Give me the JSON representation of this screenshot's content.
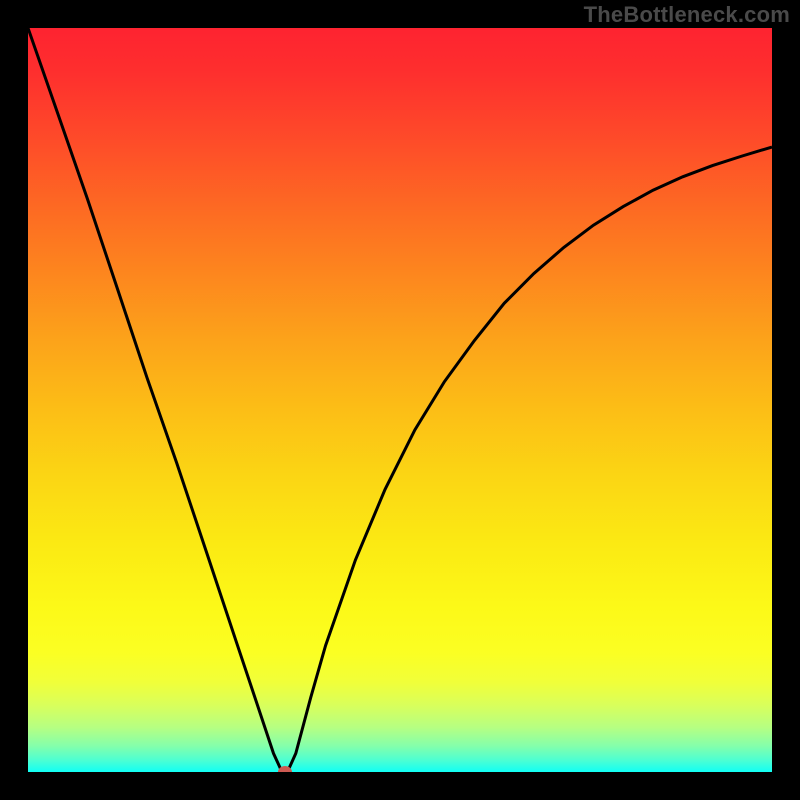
{
  "attribution": "TheBottleneck.com",
  "colors": {
    "page_bg": "#000000",
    "curve_stroke": "#000000",
    "marker_fill": "#cc5a52",
    "attribution_color": "#4a4a4a"
  },
  "chart_data": {
    "type": "line",
    "title": "",
    "xlabel": "",
    "ylabel": "",
    "xlim": [
      0,
      100
    ],
    "ylim": [
      0,
      100
    ],
    "x": [
      0,
      4,
      8,
      12,
      16,
      20,
      24,
      28,
      30,
      32,
      33,
      34,
      35,
      36,
      38,
      40,
      44,
      48,
      52,
      56,
      60,
      64,
      68,
      72,
      76,
      80,
      84,
      88,
      92,
      96,
      100
    ],
    "values": [
      100,
      88.5,
      77,
      65,
      53,
      41.5,
      29.5,
      17.5,
      11.5,
      5.5,
      2.5,
      0.3,
      0.3,
      2.5,
      10,
      17,
      28.5,
      38,
      46,
      52.5,
      58,
      63,
      67,
      70.5,
      73.5,
      76,
      78.2,
      80,
      81.5,
      82.8,
      84
    ],
    "marker": {
      "x": 34.6,
      "y": 0
    },
    "notes": "Axes are unlabeled in the source image; x and y are normalized to 0–100 from visual estimation of the plotted curve. The curve is a sharp V / check-mark shape with its minimum at roughly x≈34.5. Background is a vertical rainbow gradient (red→yellow→green) indicating bottleneck severity (green at bottom = ideal)."
  }
}
